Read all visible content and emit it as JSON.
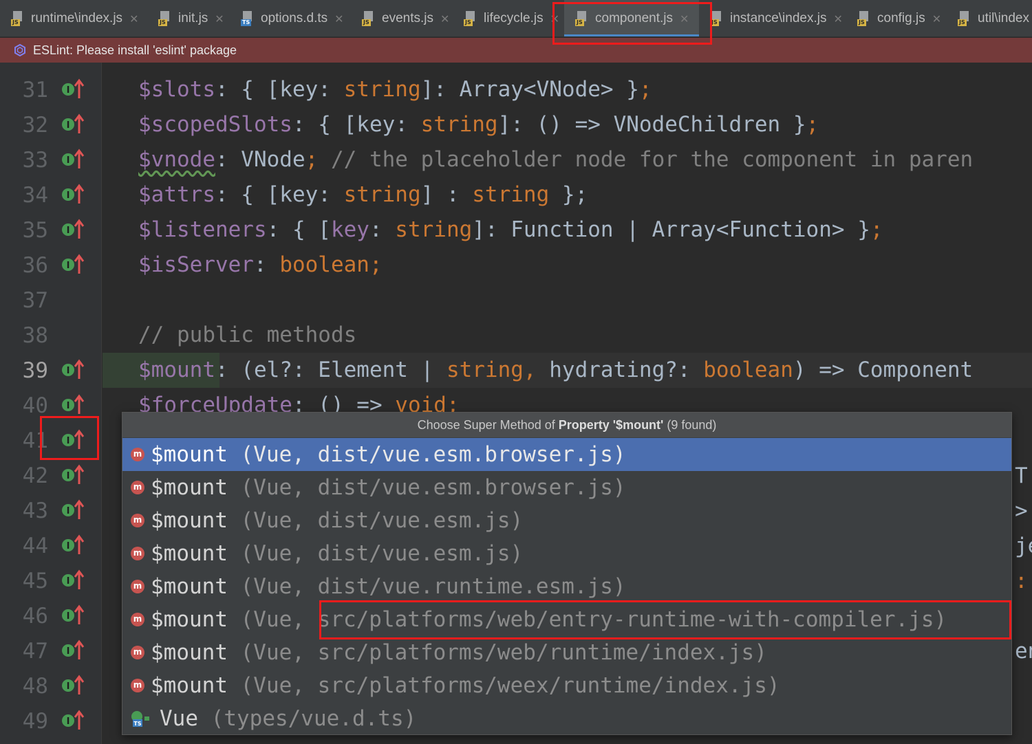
{
  "tabs": [
    {
      "label": "runtime\\index.js",
      "type": "JS"
    },
    {
      "label": "init.js",
      "type": "JS"
    },
    {
      "label": "options.d.ts",
      "type": "TS"
    },
    {
      "label": "events.js",
      "type": "JS"
    },
    {
      "label": "lifecycle.js",
      "type": "JS"
    },
    {
      "label": "component.js",
      "type": "JS",
      "active": true
    },
    {
      "label": "instance\\index.js",
      "type": "JS"
    },
    {
      "label": "config.js",
      "type": "JS"
    },
    {
      "label": "util\\index",
      "type": "JS"
    }
  ],
  "banner": {
    "text": "ESLint: Please install 'eslint' package"
  },
  "gutter": {
    "line_numbers": [
      "31",
      "32",
      "33",
      "34",
      "35",
      "36",
      "37",
      "38",
      "39",
      "40",
      "41",
      "42",
      "43",
      "44",
      "45",
      "46",
      "47",
      "48",
      "49"
    ],
    "current_line": "39",
    "icon": "implements-super-method-icon"
  },
  "code": {
    "line31": {
      "name": "$slots",
      "rest": ": { [key: ",
      "t1": "string",
      "rest2": "]: Array<VNode> }",
      "semi": ";"
    },
    "line32": {
      "name": "$scopedSlots",
      "rest": ": { [key: ",
      "t1": "string",
      "rest2": "]: () => VNodeChildren }",
      "semi": ";"
    },
    "line33": {
      "name": "$vnode",
      "rest": ": VNode",
      "semi": ";",
      "comment": " // the placeholder node for the component in paren"
    },
    "line34": {
      "name": "$attrs",
      "rest": ": { [key: ",
      "t1": "string",
      "rest2": "] : ",
      "t2": "string",
      "rest3": " };"
    },
    "line35": {
      "name": "$listeners",
      "rest": ": { [",
      "key": "key",
      "rest2": ": ",
      "t1": "string",
      "rest3": "]: Function | Array<Function> }",
      "semi": ";"
    },
    "line36": {
      "name": "$isServer",
      "rest": ": ",
      "t1": "boolean",
      "semi": ";"
    },
    "line38": {
      "comment": "// public methods"
    },
    "line39": {
      "name": "$mount",
      "rest": ": (el?: Element | ",
      "t1": "string",
      "comma": ",",
      "rest2": " hydrating?: ",
      "t2": "boolean",
      "rest3": ") => Component"
    },
    "line40": {
      "name": "$forceUpdate",
      "rest": ": () => ",
      "t1": "void",
      "semi": ";"
    }
  },
  "peek": {
    "line42": "T",
    "line43": ">",
    "line44": "je",
    "line45": ":",
    "line47": "en"
  },
  "popup": {
    "title_prefix": "Choose Super Method of ",
    "title_bold": "Property '$mount'",
    "title_suffix": " (9 found)",
    "items": [
      {
        "name": "$mount",
        "location": " (Vue, dist/vue.esm.browser.js)",
        "icon": "method-icon",
        "selected": true
      },
      {
        "name": "$mount",
        "location": " (Vue, dist/vue.esm.browser.js)",
        "icon": "method-icon"
      },
      {
        "name": "$mount",
        "location": " (Vue, dist/vue.esm.js)",
        "icon": "method-icon"
      },
      {
        "name": "$mount",
        "location": " (Vue, dist/vue.esm.js)",
        "icon": "method-icon"
      },
      {
        "name": "$mount",
        "location": " (Vue, dist/vue.runtime.esm.js)",
        "icon": "method-icon"
      },
      {
        "name": "$mount",
        "location": " (Vue, src/platforms/web/entry-runtime-with-compiler.js)",
        "icon": "method-icon"
      },
      {
        "name": "$mount",
        "location": " (Vue, src/platforms/web/runtime/index.js)",
        "icon": "method-icon"
      },
      {
        "name": "$mount",
        "location": " (Vue, src/platforms/weex/runtime/index.js)",
        "icon": "method-icon"
      },
      {
        "name": "Vue",
        "location": " (types/vue.d.ts)",
        "icon": "ts-class-icon"
      }
    ]
  },
  "colors": {
    "highlight_box": "#ee1c1c",
    "selection": "#4b6eaf",
    "banner": "#743a3a",
    "tab_underline": "#4a88c7"
  }
}
